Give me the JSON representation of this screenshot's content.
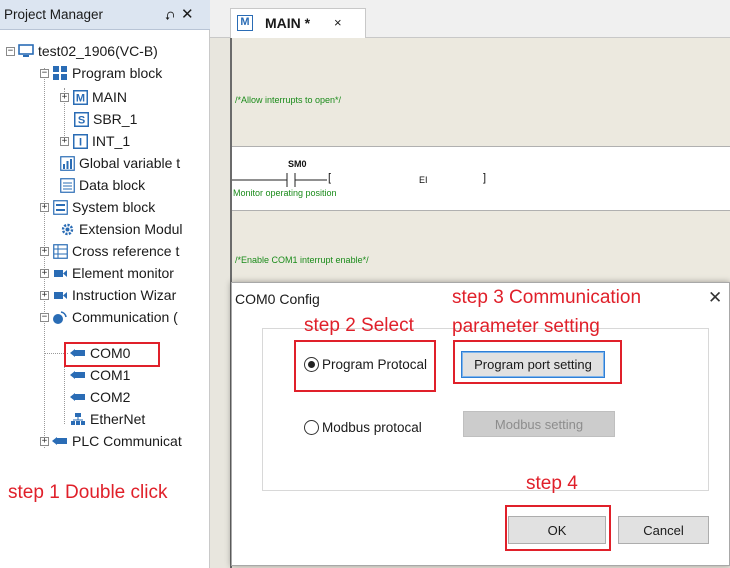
{
  "project_manager": {
    "title": "Project Manager",
    "pin_glyph": "⮏",
    "close_glyph": "✕",
    "tree": {
      "root": "test02_1906(VC-B)",
      "program_block": "Program block",
      "main": "MAIN",
      "sbr": "SBR_1",
      "int": "INT_1",
      "global_var": "Global variable t",
      "data_block": "Data block",
      "system_block": "System block",
      "extension": "Extension Modul",
      "cross_ref": "Cross reference t",
      "element_monitor": "Element monitor",
      "instruction_wizard": "Instruction Wizar",
      "communication": "Communication (",
      "com0": "COM0",
      "com1": "COM1",
      "com2": "COM2",
      "ethernet": "EtherNet",
      "plc_comm": "PLC Communicat"
    }
  },
  "editor": {
    "tab": {
      "icon_letter": "M",
      "label": "MAIN *",
      "close": "×"
    },
    "ladder": {
      "comment1": "/*Allow interrupts to open*/",
      "contact_label": "SM0",
      "contact_desc": "Monitor operating position",
      "coil_open": "[",
      "coil_text": "EI",
      "coil_close": "]",
      "comment2": "/*Enable COM1 interrupt enable*/"
    }
  },
  "dialog": {
    "title": "COM0 Config",
    "close": "✕",
    "radio_program": "Program Protocal",
    "radio_modbus": "Modbus protocal",
    "program_port_button": "Program port setting",
    "modbus_button": "Modbus setting",
    "ok": "OK",
    "cancel": "Cancel",
    "selected": "Program Protocal"
  },
  "annotations": {
    "step1": "step 1 Double click",
    "step2": "step 2 Select",
    "step3_line1": "step 3 Communication",
    "step3_line2": "parameter setting",
    "step4": "step 4"
  },
  "colors": {
    "annotation_red": "#e0202a",
    "comment_green": "#1a8b1a",
    "icon_blue": "#2a6cb5",
    "header_bg": "#dce5f1"
  }
}
